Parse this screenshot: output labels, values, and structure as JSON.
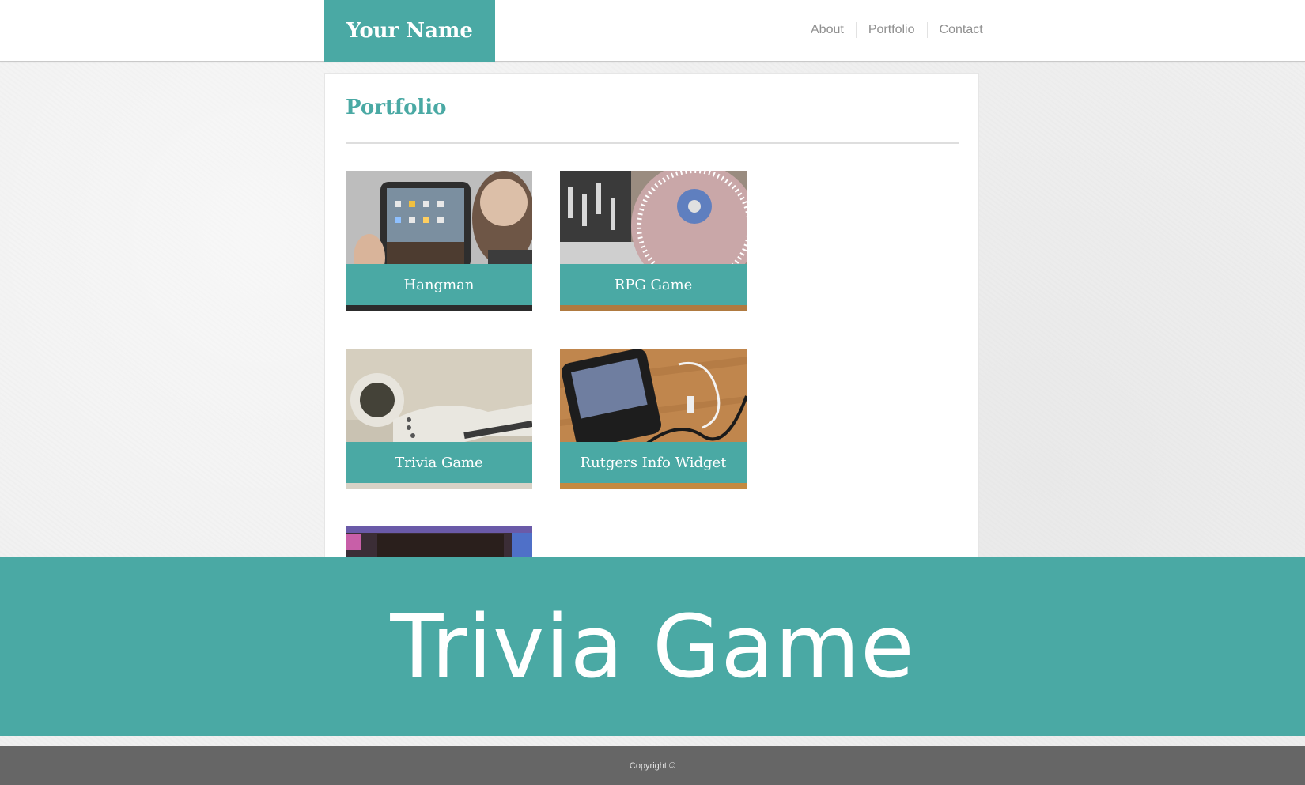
{
  "header": {
    "brand": "Your Name",
    "nav": [
      "About",
      "Portfolio",
      "Contact"
    ]
  },
  "main": {
    "title": "Portfolio",
    "tiles": [
      {
        "label": "Hangman"
      },
      {
        "label": "RPG Game"
      },
      {
        "label": "Trivia Game"
      },
      {
        "label": "Rutgers Info Widget"
      }
    ]
  },
  "overlay": {
    "title": "Trivia Game"
  },
  "footer": {
    "copyright": "Copyright ©"
  },
  "colors": {
    "accent": "#4aa9a4",
    "footer": "#666666",
    "nav_text": "#8f8f8f"
  }
}
